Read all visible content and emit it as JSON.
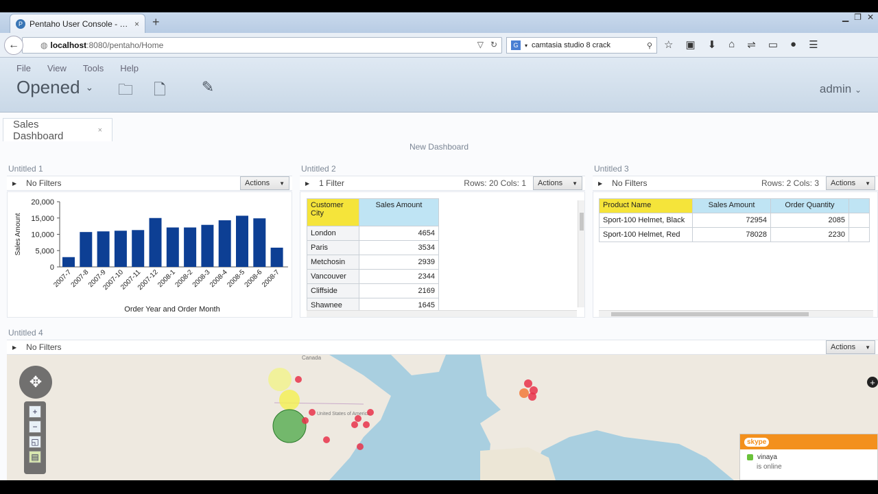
{
  "browser": {
    "tab_title": "Pentaho User Console - Sales ...",
    "tab_favicon": "pentaho-icon",
    "new_tab": "+",
    "url_host": "localhost",
    "url_rest": ":8080/pentaho/Home",
    "search_text": "camtasia studio 8 crack",
    "search_engine": "G"
  },
  "puc": {
    "menu": [
      "File",
      "View",
      "Tools",
      "Help"
    ],
    "opened_label": "Opened",
    "user": "admin"
  },
  "doc_tab": {
    "label": "Sales Dashboard",
    "close": "×"
  },
  "dashboard_title": "New Dashboard",
  "panel1": {
    "title": "Untitled 1",
    "filters": "No Filters",
    "actions": "Actions"
  },
  "panel2": {
    "title": "Untitled 2",
    "filters": "1 Filter",
    "rowcols": "Rows: 20  Cols: 1",
    "actions": "Actions",
    "headers": [
      "Customer City",
      "Sales Amount"
    ],
    "rows": [
      [
        "London",
        "4654"
      ],
      [
        "Paris",
        "3534"
      ],
      [
        "Metchosin",
        "2939"
      ],
      [
        "Vancouver",
        "2344"
      ],
      [
        "Cliffside",
        "2169"
      ],
      [
        "Shawnee",
        "1645"
      ]
    ]
  },
  "panel3": {
    "title": "Untitled 3",
    "filters": "No Filters",
    "rowcols": "Rows: 2  Cols: 3",
    "actions": "Actions",
    "headers": [
      "Product Name",
      "Sales Amount",
      "Order Quantity"
    ],
    "rows": [
      [
        "Sport-100 Helmet, Black",
        "72954",
        "2085"
      ],
      [
        "Sport-100 Helmet, Red",
        "78028",
        "2230"
      ]
    ]
  },
  "panel4": {
    "title": "Untitled 4",
    "filters": "No Filters",
    "actions": "Actions",
    "map_labels": [
      "Canada",
      "United States of America"
    ]
  },
  "skype": {
    "logo": "skype",
    "user": "vinaya",
    "status": "is online"
  },
  "colors": {
    "bar": "#0d3f94",
    "yellow_header": "#f5e43a",
    "blue_header": "#bfe4f4",
    "skype_orange": "#f3901d"
  },
  "chart_data": {
    "type": "bar",
    "categories": [
      "2007-7",
      "2007-8",
      "2007-9",
      "2007-10",
      "2007-11",
      "2007-12",
      "2008-1",
      "2008-2",
      "2008-3",
      "2008-4",
      "2008-5",
      "2008-6",
      "2008-7"
    ],
    "values": [
      3000,
      10700,
      10900,
      11100,
      11300,
      15000,
      12100,
      12100,
      12900,
      14300,
      15700,
      14900,
      5900
    ],
    "xlabel": "Order Year and Order Month",
    "ylabel": "Sales Amount",
    "ylim": [
      0,
      20000
    ],
    "yticks": [
      "0",
      "5,000",
      "10,000",
      "15,000",
      "20,000"
    ],
    "grid": false
  }
}
